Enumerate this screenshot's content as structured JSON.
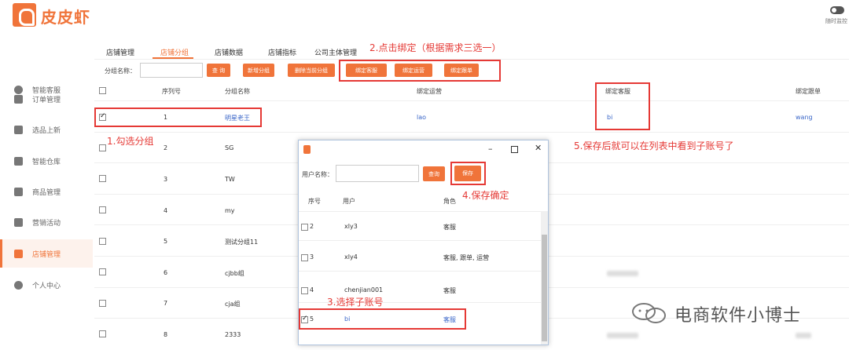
{
  "app": {
    "brand": "皮皮虾",
    "toggle_label": "随时监控"
  },
  "sidebar": {
    "items": [
      {
        "label": "智能客服",
        "icon": "chat-icon"
      },
      {
        "label": "订单管理",
        "icon": "list-icon"
      },
      {
        "label": "选品上新",
        "icon": "tag-icon"
      },
      {
        "label": "智能仓库",
        "icon": "warehouse-icon"
      },
      {
        "label": "商品管理",
        "icon": "box-icon"
      },
      {
        "label": "营销活动",
        "icon": "promotion-icon"
      },
      {
        "label": "店铺管理",
        "icon": "store-icon",
        "active": true
      },
      {
        "label": "个人中心",
        "icon": "user-icon"
      }
    ]
  },
  "tabs": [
    "店铺管理",
    "店铺分组",
    "店铺数据",
    "店铺指标",
    "公司主体管理"
  ],
  "toolbar": {
    "group_name_label": "分组名称：",
    "search": "查 询",
    "add_group": "新增分组",
    "delete_group": "删除当前分组",
    "bind_cs": "绑定客服",
    "bind_ops": "绑定运营",
    "bind_follow": "绑定跟单"
  },
  "table": {
    "headers": [
      "序列号",
      "分组名称",
      "绑定运营",
      "绑定客服",
      "绑定跟单"
    ],
    "rows": [
      {
        "no": "1",
        "name": "明星老王",
        "ops": "lao",
        "cs": "bi",
        "follow": "wang",
        "checked": true
      },
      {
        "no": "2",
        "name": "SG"
      },
      {
        "no": "3",
        "name": "TW"
      },
      {
        "no": "4",
        "name": "my"
      },
      {
        "no": "5",
        "name": "测试分组11"
      },
      {
        "no": "6",
        "name": "cjbb组"
      },
      {
        "no": "7",
        "name": "cja组"
      },
      {
        "no": "8",
        "name": "2333"
      }
    ]
  },
  "modal": {
    "username_label": "用户名称：",
    "search": "查询",
    "save": "保存",
    "headers": [
      "序号",
      "用户",
      "角色"
    ],
    "rows": [
      {
        "no": "2",
        "user": "xly3",
        "role": "客服"
      },
      {
        "no": "3",
        "user": "xly4",
        "role": "客服, 跟单, 运营"
      },
      {
        "no": "4",
        "user": "chenjian001",
        "role": "客服"
      },
      {
        "no": "5",
        "user": "bi",
        "role": "客服",
        "checked": true
      }
    ]
  },
  "annotations": {
    "step1": "1.勾选分组",
    "step2": "2.点击绑定（根据需求三选一）",
    "step3": "3.选择子账号",
    "step4": "4.保存确定",
    "step5": "5.保存后就可以在列表中看到子账号了"
  },
  "watermark": "电商软件小博士",
  "colors": {
    "accent": "#f0743a",
    "annotation": "#e53935",
    "link": "#3a66c8"
  }
}
